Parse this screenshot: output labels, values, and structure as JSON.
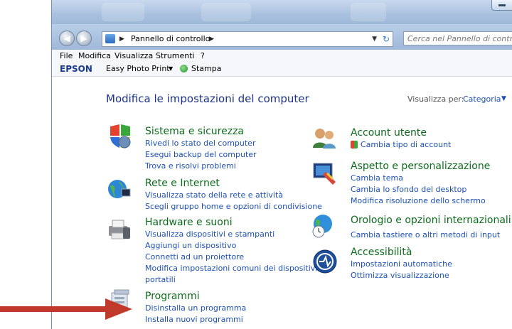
{
  "address": {
    "crumb": "Pannello di controllo"
  },
  "search": {
    "placeholder": "Cerca nel Pannello di controllo"
  },
  "menu": [
    "File",
    "Modifica",
    "Visualizza",
    "Strumenti",
    "?"
  ],
  "epson": {
    "logo": "EPSON",
    "app": "Easy Photo Print",
    "print": "Stampa"
  },
  "main": {
    "heading": "Modifica le impostazioni del computer",
    "view_by": "Visualizza per:",
    "view_mode": "Categoria"
  },
  "left": [
    {
      "title": "Sistema e sicurezza",
      "links": [
        "Rivedi lo stato del computer",
        "Esegui backup del computer",
        "Trova e risolvi problemi"
      ]
    },
    {
      "title": "Rete e Internet",
      "links": [
        "Visualizza stato della rete e attività",
        "Scegli gruppo home e opzioni di condivisione"
      ]
    },
    {
      "title": "Hardware e suoni",
      "links": [
        "Visualizza dispositivi e stampanti",
        "Aggiungi un dispositivo",
        "Connetti ad un proiettore",
        "Modifica impostazioni comuni dei dispositivi",
        "portatili"
      ]
    },
    {
      "title": "Programmi",
      "links": [
        "Disinstalla un programma",
        "Installa nuovi programmi"
      ]
    }
  ],
  "right": [
    {
      "title": "Account utente",
      "links": [
        "Cambia tipo di account"
      ]
    },
    {
      "title": "Aspetto e personalizzazione",
      "links": [
        "Cambia tema",
        "Cambia lo sfondo del desktop",
        "Modifica risoluzione dello schermo"
      ]
    },
    {
      "title": "Orologio e opzioni internazionali",
      "links": [
        "Cambia tastiere o altri metodi di input"
      ]
    },
    {
      "title": "Accessibilità",
      "links": [
        "Impostazioni automatiche",
        "Ottimizza visualizzazione"
      ]
    }
  ],
  "colors": {
    "category_title": "#0e6b1e",
    "link": "#1e50b4",
    "heading": "#1e3287",
    "arrow": "#c0392b"
  }
}
